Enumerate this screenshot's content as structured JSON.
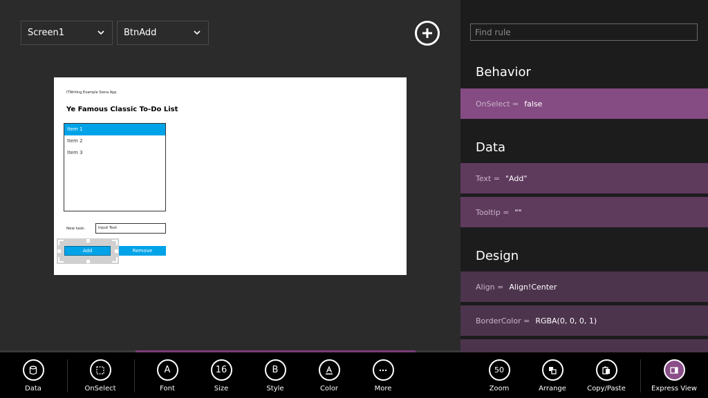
{
  "toolbar": {
    "screen_select": "Screen1",
    "control_select": "BtnAdd"
  },
  "canvas": {
    "caption": "ITWriting Example Siena App",
    "title": "Ye Famous Classic To-Do List",
    "list_items": [
      "Item 1",
      "Item 2",
      "Item 3"
    ],
    "new_task_label": "New task:",
    "new_task_value": "Input Text",
    "add_button": "Add",
    "remove_button": "Remove"
  },
  "rules": {
    "search_placeholder": "Find rule",
    "sections": {
      "behavior": "Behavior",
      "data": "Data",
      "design": "Design"
    },
    "items": [
      {
        "name": "OnSelect =",
        "value": "false"
      },
      {
        "name": "Text =",
        "value": "\"Add\""
      },
      {
        "name": "Tooltip =",
        "value": "\"\""
      },
      {
        "name": "Align =",
        "value": "Align!Center"
      },
      {
        "name": "BorderColor =",
        "value": "RGBA(0, 0, 0, 1)"
      }
    ]
  },
  "app_bar": {
    "data": "Data",
    "onselect": "OnSelect",
    "font": "Font",
    "size": "Size",
    "size_value": "16",
    "style": "Style",
    "color": "Color",
    "more": "More",
    "zoom": "Zoom",
    "zoom_value": "50",
    "arrange": "Arrange",
    "copy_paste": "Copy/Paste",
    "express_view": "Express View"
  },
  "colors": {
    "accent": "#00a3e8",
    "rule_active": "#854b83",
    "rule": "#5e3a5d"
  }
}
